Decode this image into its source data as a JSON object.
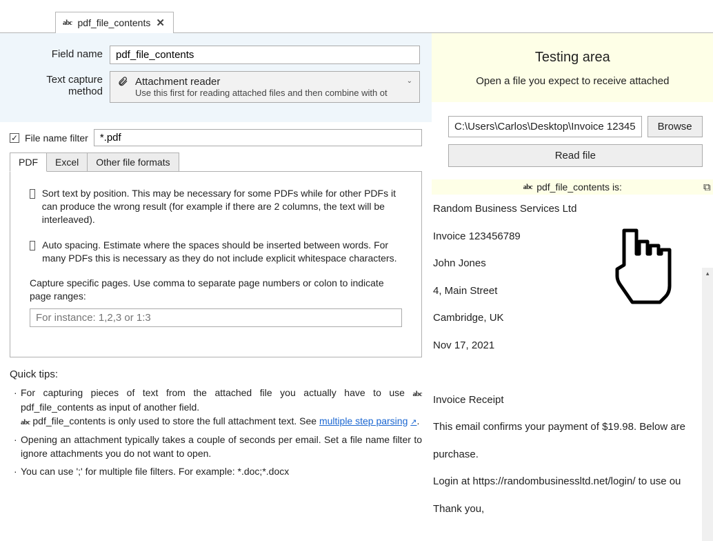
{
  "tab": {
    "label": "pdf_file_contents"
  },
  "form": {
    "field_name_label": "Field name",
    "field_name_value": "pdf_file_contents",
    "capture_method_label": "Text capture method",
    "capture_method_title": "Attachment reader",
    "capture_method_desc": "Use this first for reading attached files and then combine with ot"
  },
  "filter": {
    "checkbox_checked": true,
    "label": "File name filter",
    "value": "*.pdf"
  },
  "inner_tabs": [
    {
      "label": "PDF",
      "current": true
    },
    {
      "label": "Excel",
      "current": false
    },
    {
      "label": "Other file formats",
      "current": false
    }
  ],
  "pdf_options": {
    "sort_text": "Sort text by position. This may be necessary for some PDFs while for other PDFs it can produce the wrong result (for example if there are 2 columns, the text will be interleaved).",
    "auto_spacing": "Auto spacing. Estimate where the spaces should be inserted between words. For many PDFs this is necessary as they do not include explicit whitespace characters.",
    "pages_caption": "Capture specific pages. Use comma to separate page numbers or colon to indicate page ranges:",
    "pages_placeholder": "For instance: 1,2,3 or 1:3"
  },
  "tips": {
    "heading": "Quick tips:",
    "tip1_prefix": "For capturing pieces of text from the attached file you actually have to use ",
    "tip1_field": "pdf_file_contents as input of another field.",
    "tip1b_field": "pdf_file_contents is only used to store the full attachment text. See ",
    "tip1_link": "multiple step parsing",
    "tip2": "Opening an attachment typically takes a couple of seconds per email. Set a file name filter to ignore attachments you do not want to open.",
    "tip3": "You can use ';' for multiple file filters. For example: *.doc;*.docx"
  },
  "testing": {
    "heading": "Testing area",
    "subheading": "Open a file you expect to receive attached",
    "path_value": "C:\\Users\\Carlos\\Desktop\\Invoice 12345",
    "browse_label": "Browse",
    "read_label": "Read file",
    "result_label": "pdf_file_contents is:",
    "lines": [
      "Random Business Services Ltd",
      "Invoice 123456789",
      "John Jones",
      "4, Main Street",
      "Cambridge, UK",
      "Nov 17, 2021",
      "",
      "Invoice Receipt",
      "This email confirms your payment of $19.98. Below are",
      "purchase.",
      "Login at https://randombusinessltd.net/login/ to use ou",
      "Thank you,"
    ]
  }
}
